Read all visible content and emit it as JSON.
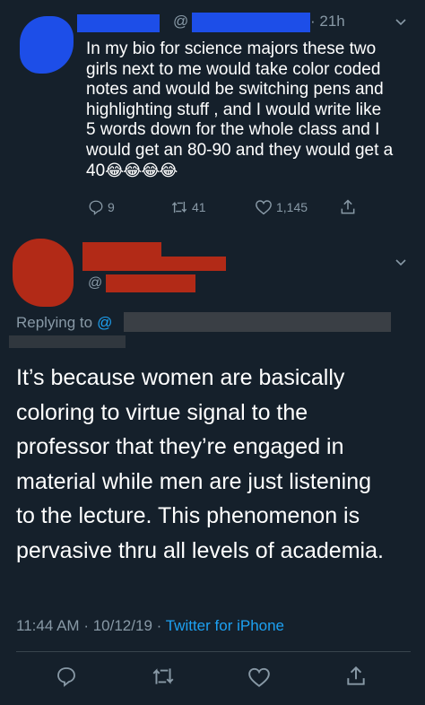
{
  "tweet": {
    "handle_at": "@",
    "time": "21h",
    "text": "In my bio for science majors these two\ngirls next to me would take color coded\nnotes and would be switching pens and\nhighlighting stuff , and I would write like\n5 words down for the whole class and I\nwould get an 80-90 and they would get a\n40",
    "emoji": "😂😂😂😂",
    "reply_count": "9",
    "retweet_count": "41",
    "like_count": "1,145"
  },
  "reply": {
    "handle_at": "@",
    "replying_to_label": "Replying to",
    "replying_to_at": "@",
    "body": "It’s because women are basically\ncoloring to virtue signal to the\nprofessor that they’re engaged in\nmaterial while men are just listening\nto the lecture. This phenomenon is\npervasive thru all levels of academia.",
    "time": "11:44 AM",
    "date": "10/12/19",
    "separator": "·",
    "client": "Twitter for iPhone"
  },
  "colors": {
    "background": "#15202b",
    "muted": "#8899a6",
    "link": "#1da1f2"
  },
  "icons": [
    "reply-icon",
    "retweet-icon",
    "like-icon",
    "share-icon",
    "chevron-down-icon"
  ]
}
